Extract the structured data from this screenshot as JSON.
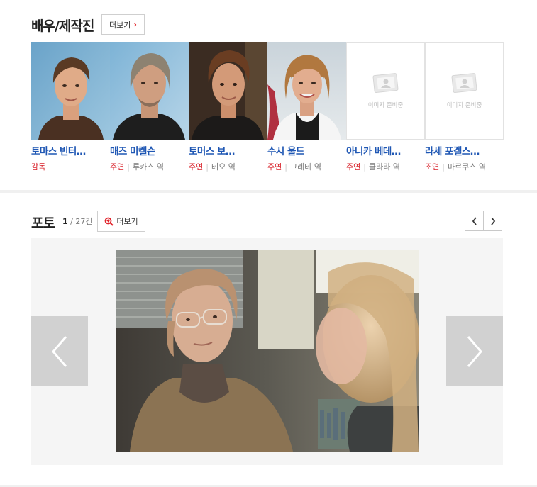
{
  "cast_section": {
    "title": "배우/제작진",
    "more_label": "더보기",
    "placeholder_text": "이미지 준비중",
    "members": [
      {
        "name": "토마스 빈터…",
        "type": "감독",
        "role": ""
      },
      {
        "name": "매즈 미켈슨",
        "type": "주연",
        "role": "루카스 역"
      },
      {
        "name": "토머스 보…",
        "type": "주연",
        "role": "테오 역"
      },
      {
        "name": "수시 울드",
        "type": "주연",
        "role": "그레테 역"
      },
      {
        "name": "아니카 베데…",
        "type": "주연",
        "role": "클라라 역"
      },
      {
        "name": "라세 포겔스…",
        "type": "조연",
        "role": "마르쿠스 역"
      }
    ]
  },
  "photo_section": {
    "title": "포토",
    "current": "1",
    "total": "27건",
    "more_label": "더보기"
  },
  "colors": {
    "accent_red": "#e1262d",
    "link_blue": "#1f57b4"
  },
  "icons": [
    "chevron-right-icon",
    "zoom-icon",
    "chevron-left-icon",
    "image-placeholder-icon"
  ]
}
